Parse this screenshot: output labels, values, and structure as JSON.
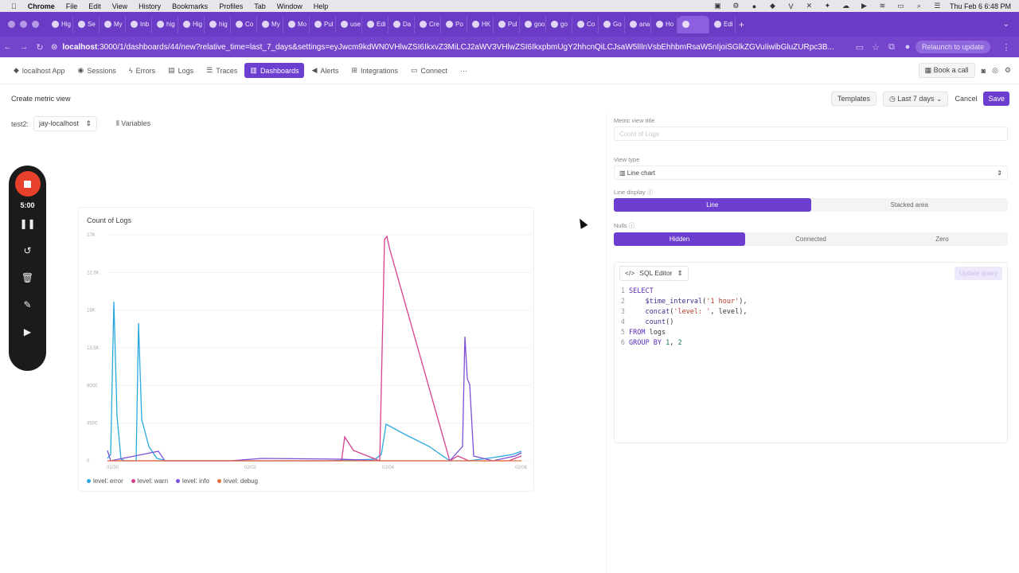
{
  "mac": {
    "apple": "",
    "app": "Chrome",
    "menus": [
      "File",
      "Edit",
      "View",
      "History",
      "Bookmarks",
      "Profiles",
      "Tab",
      "Window",
      "Help"
    ],
    "clock": "Thu Feb 6  6:48 PM"
  },
  "tabs": [
    "Hig",
    "Se",
    "My",
    "Inb",
    "hig",
    "Hig",
    "hig",
    "Co",
    "My",
    "Mo",
    "Pul",
    "use",
    "Edi",
    "Da",
    "Cre",
    "Po",
    "HK",
    "Pul",
    "goo",
    "go",
    "Co",
    "Go",
    "ana",
    "Ho",
    "",
    "Edi"
  ],
  "address": {
    "host": "localhost",
    "rest": ":3000/1/dashboards/44/new?relative_time=last_7_days&settings=eyJwcm9kdWN0VHlwZSI6IkxvZ3MiLCJ2aWV3VHlwZSI6IkxpbmUgY2hhcnQiLCJsaW5lIlnVsbEhhbmRsaW5nIjoiSGlkZGVuIiwibGluZURpc3B...",
    "relaunch": "Relaunch to update"
  },
  "nav": {
    "items": [
      "localhost App",
      "Sessions",
      "Errors",
      "Logs",
      "Traces",
      "Dashboards",
      "Alerts",
      "Integrations",
      "Connect"
    ],
    "more": "···",
    "book_call": "Book a call"
  },
  "header": {
    "title": "Create metric view",
    "templates": "Templates",
    "time_range": "Last 7 days",
    "cancel": "Cancel",
    "save": "Save"
  },
  "variables": {
    "name": "test2:",
    "value": "jay-localhost",
    "button": "Variables"
  },
  "recorder": {
    "time": "5:00"
  },
  "chart_data": {
    "type": "line",
    "title": "Count of Logs",
    "x": [
      "01/30",
      "02/02",
      "02/04",
      "02/06"
    ],
    "yticks": [
      "27K",
      "22.5K",
      "18K",
      "13.5K",
      "9000",
      "4500",
      "0"
    ],
    "ylim": [
      0,
      27000
    ],
    "series": [
      {
        "name": "level: error",
        "color": "#2aa7e0"
      },
      {
        "name": "level: warn",
        "color": "#d6418f"
      },
      {
        "name": "level: info",
        "color": "#7b4fd9"
      },
      {
        "name": "level: debug",
        "color": "#e8713a"
      }
    ]
  },
  "panel": {
    "title_label": "Metric view title",
    "title_placeholder": "Count of Logs",
    "view_type_label": "View type",
    "view_type": "Line chart",
    "line_display_label": "Line display",
    "line_display": [
      "Line",
      "Stacked area"
    ],
    "nulls_label": "Nulls",
    "nulls": [
      "Hidden",
      "Connected",
      "Zero"
    ],
    "editor": "SQL Editor",
    "update": "Update query",
    "code": [
      [
        "1",
        "SELECT"
      ],
      [
        "2",
        "    $time_interval('1 hour'),"
      ],
      [
        "3",
        "    concat('level: ', level),"
      ],
      [
        "4",
        "    count()"
      ],
      [
        "5",
        "FROM logs"
      ],
      [
        "6",
        "GROUP BY 1, 2"
      ]
    ]
  }
}
